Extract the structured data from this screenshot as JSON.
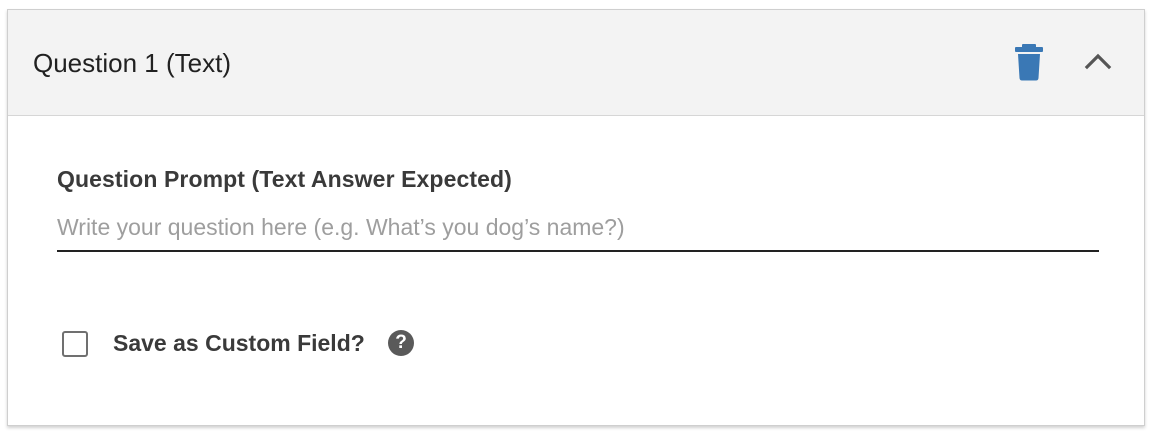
{
  "question": {
    "title": "Question 1 (Text)",
    "delete_icon": "trash-icon",
    "collapse_icon": "chevron-up-icon",
    "prompt_label": "Question Prompt (Text Answer Expected)",
    "prompt_value": "",
    "prompt_placeholder": "Write your question here (e.g. What’s you dog’s name?)",
    "custom_field_label": "Save as Custom Field?",
    "custom_field_checked": false,
    "help_icon": "help-circle-icon",
    "help_glyph": "?"
  },
  "colors": {
    "header_bg": "#f3f3f3",
    "trash_icon": "#3a78b5",
    "chevron_icon": "#555555",
    "help_icon_bg": "#5a5a5a"
  }
}
